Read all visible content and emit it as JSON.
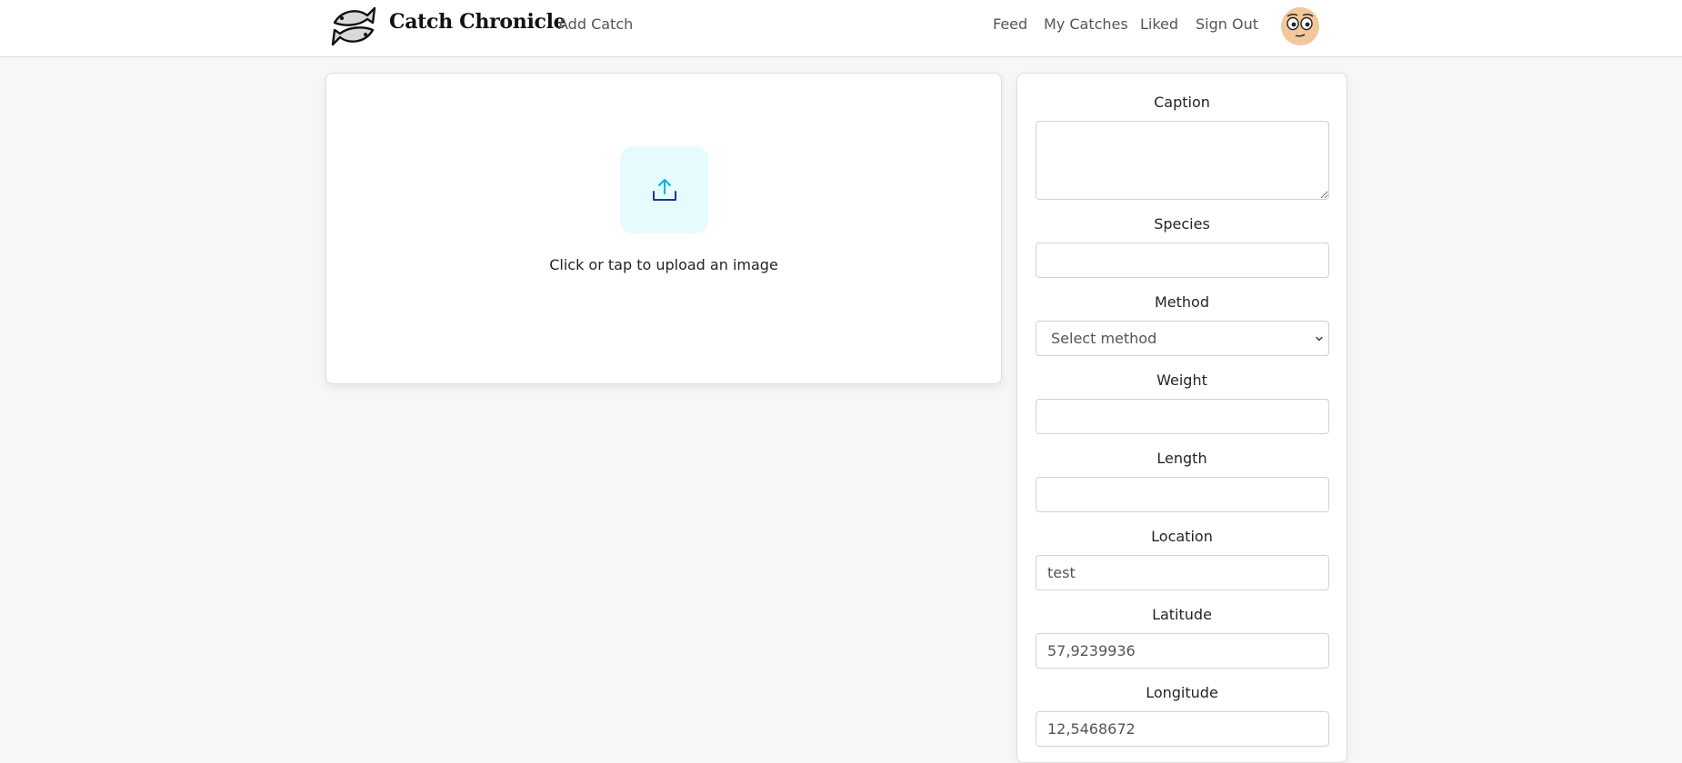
{
  "app": {
    "title": "Catch Chronicle",
    "accent_color": "#00b4d8"
  },
  "nav": {
    "add_catch": "Add Catch",
    "feed": "Feed",
    "my_catches": "My Catches",
    "liked": "Liked",
    "sign_out": "Sign Out"
  },
  "upload": {
    "prompt": "Click or tap to upload an image",
    "icon": "upload-icon"
  },
  "form": {
    "caption": {
      "label": "Caption",
      "value": ""
    },
    "species": {
      "label": "Species",
      "value": ""
    },
    "method": {
      "label": "Method",
      "placeholder": "Select method"
    },
    "weight": {
      "label": "Weight",
      "value": ""
    },
    "length": {
      "label": "Length",
      "value": ""
    },
    "location": {
      "label": "Location",
      "value": "test"
    },
    "latitude": {
      "label": "Latitude",
      "value": "57,9239936"
    },
    "longitude": {
      "label": "Longitude",
      "value": "12,5468672"
    }
  }
}
